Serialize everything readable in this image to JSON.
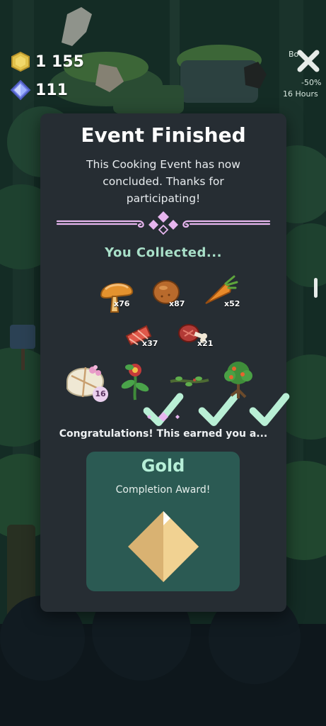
{
  "hud": {
    "coins": "1 155",
    "gems": "111"
  },
  "event_timer": {
    "label_partial": "Bo",
    "discount": "-50%",
    "time_left": "16 Hours"
  },
  "modal": {
    "title": "Event Finished",
    "description": "This Cooking Event has now concluded. Thanks for participating!",
    "collected_title": "You Collected...",
    "items": [
      {
        "name": "mushroom",
        "qty": "x76"
      },
      {
        "name": "potato",
        "qty": "x87"
      },
      {
        "name": "carrot",
        "qty": "x52"
      },
      {
        "name": "fish-steak",
        "qty": "x37"
      },
      {
        "name": "meat-bone",
        "qty": "x21"
      }
    ],
    "rewards": [
      {
        "name": "gift-bundle",
        "badge": "16"
      },
      {
        "name": "flower-plant",
        "claimed": true
      },
      {
        "name": "vine-branch",
        "claimed": true
      },
      {
        "name": "fruit-tree",
        "claimed": true
      }
    ],
    "congrats": "Congratulations! This earned you a...",
    "award": {
      "tier": "Gold",
      "subtitle": "Completion Award!"
    }
  },
  "colors": {
    "modal_bg": "#262d33",
    "accent_mint": "#a9e0c9",
    "award_card": "#2b5a53",
    "gold": "#e8c98a",
    "divider_pink": "#e7b6ef"
  }
}
